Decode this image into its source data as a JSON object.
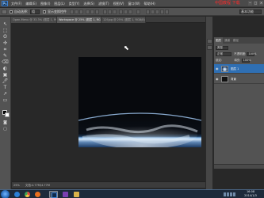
{
  "app": {
    "logo": "Ps"
  },
  "menu": {
    "items": [
      "文件(F)",
      "编辑(E)",
      "图像(I)",
      "图层(L)",
      "类型(Y)",
      "选择(S)",
      "滤镜(T)",
      "视图(V)",
      "窗口(W)",
      "帮助(H)"
    ]
  },
  "annotation": "中国教程 下载",
  "window_controls": [
    "─",
    "□",
    "✕"
  ],
  "options_bar": {
    "auto_select_label": "自动选择:",
    "auto_select_value": "组",
    "show_transform_label": "显示变换控件",
    "workspace": "基本功能"
  },
  "tabs": [
    {
      "label": "Open-Menu @ 33.3% (图层 1, RGB/8) ×"
    },
    {
      "label": "Workspace @ 25% (图层 1, RGB/8) ×"
    },
    {
      "label": "12f.jpg @ 25% (图层 1, RGB/8) ×"
    }
  ],
  "toolbar": {
    "tools": [
      "↖",
      "⬚",
      "ʘ",
      "✣",
      "⌗",
      "✎",
      "⌫",
      "◐",
      "▣",
      "🖊",
      "T",
      "↗",
      "▭",
      "✋",
      "🔍"
    ]
  },
  "status": {
    "zoom": "25%",
    "doc": "文档:4.77M/4.77M"
  },
  "layers_panel": {
    "tabs": [
      "图层",
      "通道",
      "路径"
    ],
    "kind_label": "类型",
    "blend_mode": "正常",
    "opacity_label": "不透明度:",
    "opacity_value": "100%",
    "lock_label": "锁定:",
    "fill_label": "填充:",
    "fill_value": "100%",
    "layers": [
      {
        "name": "图层 1",
        "selected": true
      },
      {
        "name": "背景",
        "selected": false
      }
    ]
  },
  "taskbar": {
    "clock_time": "16:08",
    "clock_date": "2014/1/3"
  },
  "colors": {
    "accent": "#2f6fb3",
    "annotation": "#ff2a2a",
    "workspace_bg": "#282828"
  }
}
